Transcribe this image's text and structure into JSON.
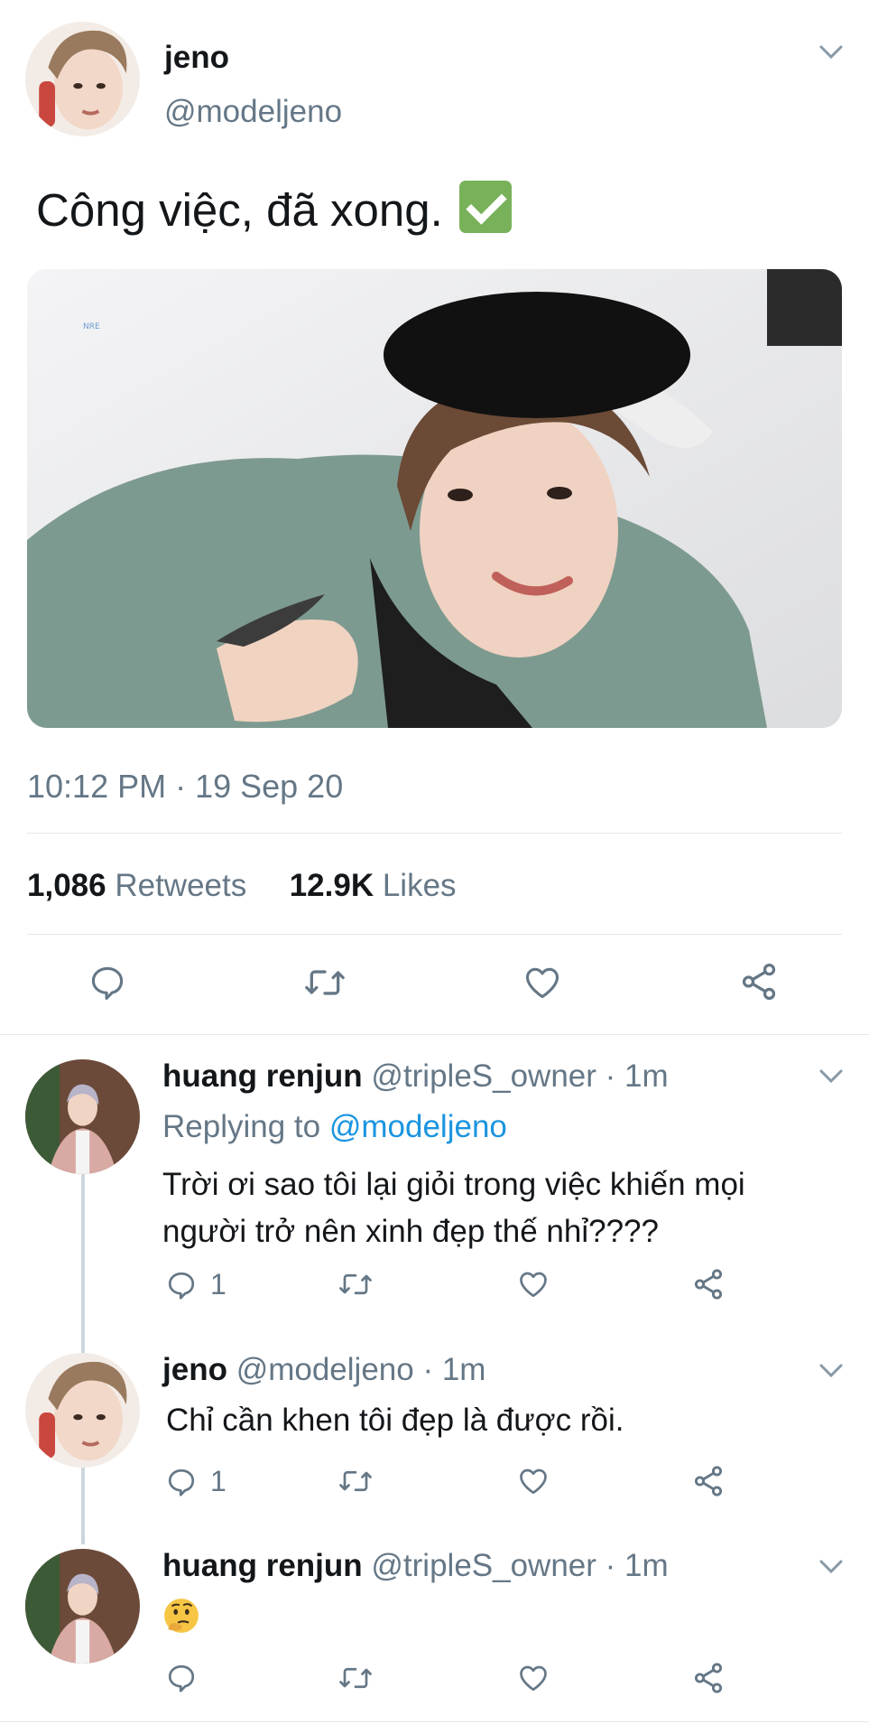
{
  "tweet": {
    "author_name": "jeno",
    "author_handle": "@modeljeno",
    "text": "Công việc, đã xong.",
    "text_emoji": "check-mark-emoji",
    "timestamp": "10:12 PM · 19 Sep 20",
    "retweet_count": "1,086",
    "retweet_label": "Retweets",
    "like_count": "12.9K",
    "like_label": "Likes",
    "photo_watermark": "NRE"
  },
  "replies": [
    {
      "name": "huang renjun",
      "handle": "@tripleS_owner",
      "time": "· 1m",
      "replying_label": "Replying to",
      "replying_to": "@modeljeno",
      "text_line1": "Trời ơi sao tôi lại giỏi trong việc khiến mọi",
      "text_line2": "người trở nên xinh đẹp thế nhỉ????",
      "reply_count": "1"
    },
    {
      "name": "jeno",
      "handle": "@modeljeno",
      "time": "· 1m",
      "text": "Chỉ cần khen tôi đẹp là được rồi.",
      "reply_count": "1"
    },
    {
      "name": "huang renjun",
      "handle": "@tripleS_owner",
      "time": "· 1m",
      "emoji": "thinking-face-emoji"
    }
  ],
  "colors": {
    "text": "#14171a",
    "muted": "#657786",
    "link": "#1b95e0",
    "divider": "#e1e8ed",
    "check_green": "#78b159"
  },
  "icons": [
    "reply-icon",
    "retweet-icon",
    "like-icon",
    "share-icon",
    "chevron-down-icon"
  ]
}
